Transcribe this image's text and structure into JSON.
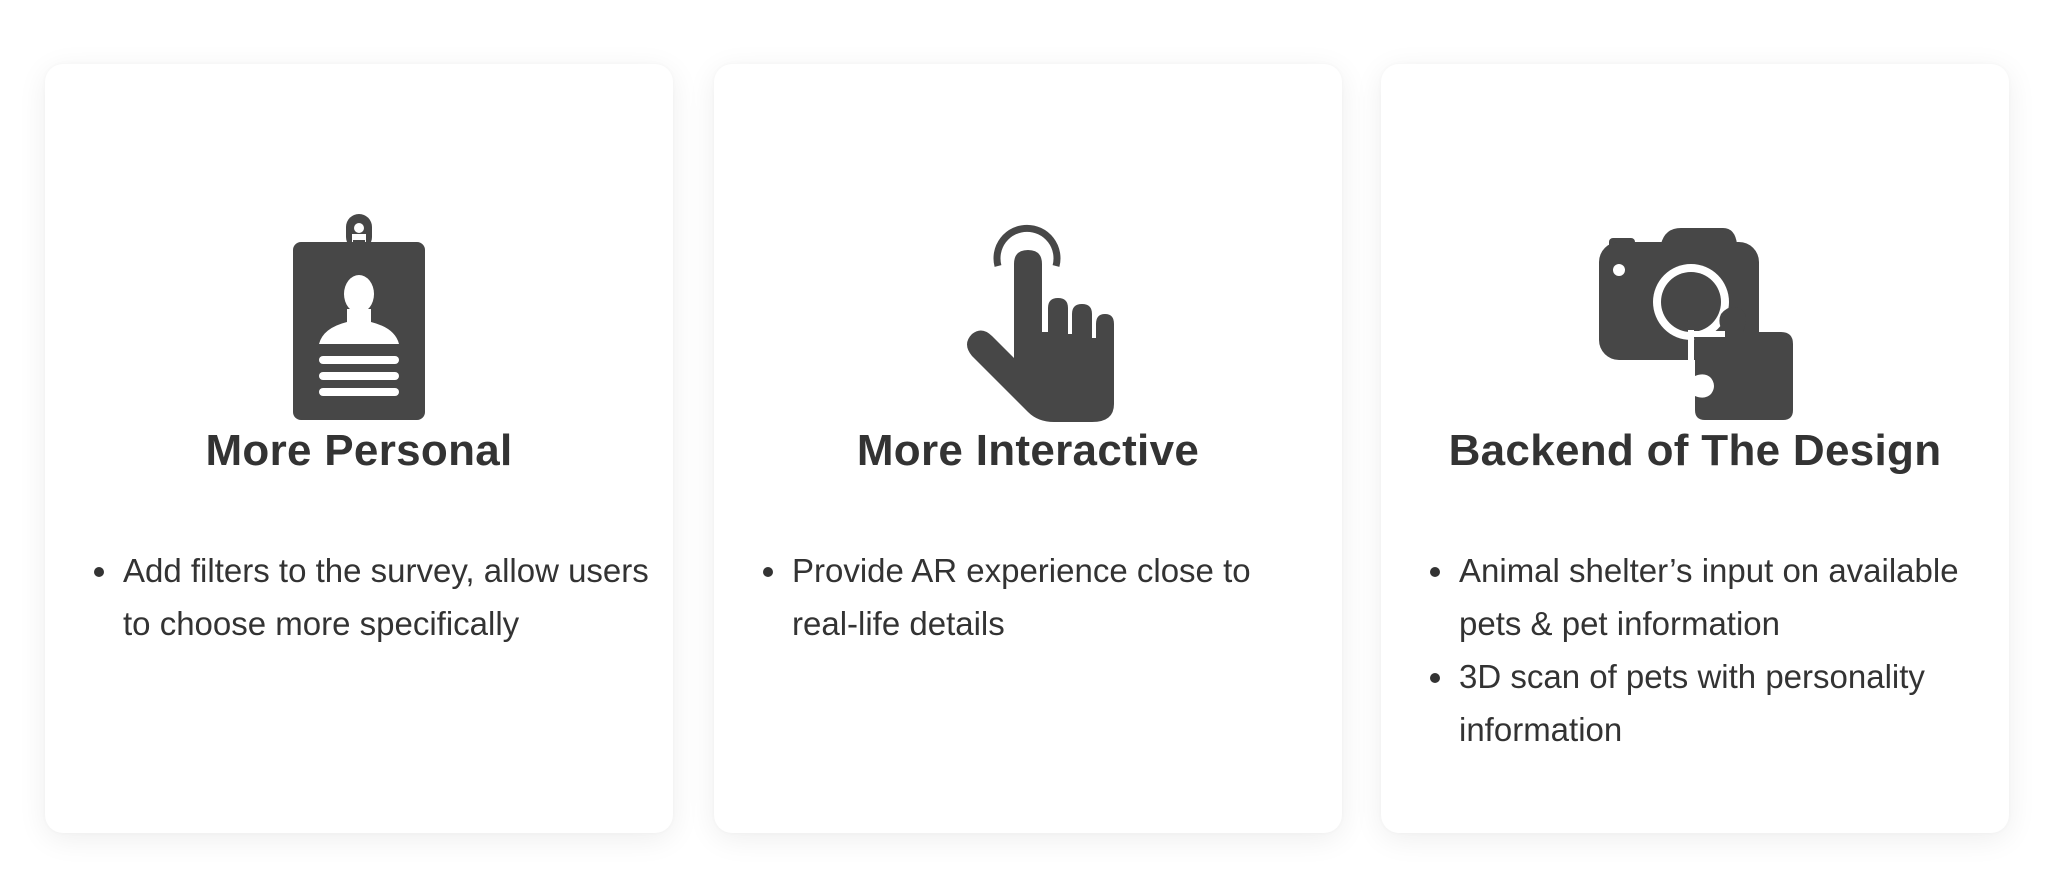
{
  "colors": {
    "icon": "#474747",
    "text": "#333333",
    "card": "#ffffff"
  },
  "cards": [
    {
      "icon": "id-badge-icon",
      "title": "More Personal",
      "bullets": [
        "Add filters to the survey, allow users to choose more specifically"
      ]
    },
    {
      "icon": "tap-hand-icon",
      "title": "More Interactive",
      "bullets": [
        "Provide AR experience close to real-life details"
      ]
    },
    {
      "icon": "camera-puzzle-icon",
      "title": "Backend of The Design",
      "bullets": [
        "Animal shelter’s input on available pets & pet information",
        "3D scan of pets with personality information"
      ]
    }
  ]
}
